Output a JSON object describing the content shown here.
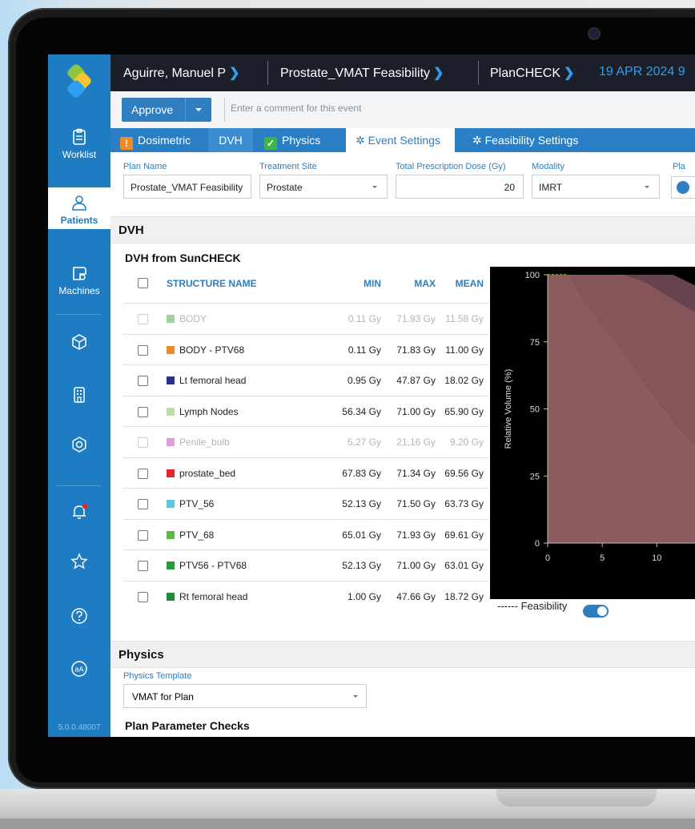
{
  "header": {
    "patient": "Aguirre, Manuel P",
    "plan": "Prostate_VMAT Feasibility",
    "module": "PlanCHECK",
    "date": "19 APR 2024 9"
  },
  "sidebar": {
    "items": [
      {
        "label": "Worklist",
        "icon": "clipboard-icon"
      },
      {
        "label": "Patients",
        "icon": "person-icon"
      },
      {
        "label": "Machines",
        "icon": "machine-icon"
      }
    ],
    "version": "5.0.0.48007"
  },
  "actionbar": {
    "approve_label": "Approve",
    "comment_placeholder": "Enter a comment for this event"
  },
  "tabs": {
    "dosimetric": "Dosimetric",
    "dvh": "DVH",
    "physics": "Physics",
    "event_settings": "Event Settings",
    "feasibility_settings": "Feasibility Settings"
  },
  "plan_fields": {
    "plan_name_label": "Plan Name",
    "plan_name": "Prostate_VMAT Feasibility",
    "treatment_site_label": "Treatment Site",
    "treatment_site": "Prostate",
    "dose_label": "Total Prescription Dose (Gy)",
    "dose": "20",
    "modality_label": "Modality",
    "modality": "IMRT",
    "cut_label": "Pla"
  },
  "dvh": {
    "section_title": "DVH",
    "subtitle": "DVH from SunCHECK",
    "columns": {
      "name": "STRUCTURE NAME",
      "min": "MIN",
      "max": "MAX",
      "mean": "MEAN"
    },
    "rows": [
      {
        "name": "BODY",
        "min": "0.11 Gy",
        "max": "71.93 Gy",
        "mean": "11.58 Gy",
        "color": "#4caf50",
        "dim": true
      },
      {
        "name": "BODY - PTV68",
        "min": "0.11 Gy",
        "max": "71.83 Gy",
        "mean": "11.00 Gy",
        "color": "#f08a24",
        "dim": false
      },
      {
        "name": "Lt femoral head",
        "min": "0.95 Gy",
        "max": "47.87 Gy",
        "mean": "18.02 Gy",
        "color": "#2b2f8f",
        "dim": false
      },
      {
        "name": "Lymph Nodes",
        "min": "56.34 Gy",
        "max": "71.00 Gy",
        "mean": "65.90 Gy",
        "color": "#b9e0a5",
        "dim": false
      },
      {
        "name": "Penile_bulb",
        "min": "5.27 Gy",
        "max": "21.16 Gy",
        "mean": "9.20 Gy",
        "color": "#c84fb0",
        "dim": true
      },
      {
        "name": "prostate_bed",
        "min": "67.83 Gy",
        "max": "71.34 Gy",
        "mean": "69.56 Gy",
        "color": "#e8232a",
        "dim": false
      },
      {
        "name": "PTV_56",
        "min": "52.13 Gy",
        "max": "71.50 Gy",
        "mean": "63.73 Gy",
        "color": "#5bc8e0",
        "dim": false
      },
      {
        "name": "PTV_68",
        "min": "65.01 Gy",
        "max": "71.93 Gy",
        "mean": "69.61 Gy",
        "color": "#5ab946",
        "dim": false
      },
      {
        "name": "PTV56 - PTV68",
        "min": "52.13 Gy",
        "max": "71.00 Gy",
        "mean": "63.01 Gy",
        "color": "#1f9e3a",
        "dim": false
      },
      {
        "name": "Rt femoral head",
        "min": "1.00 Gy",
        "max": "47.66 Gy",
        "mean": "18.72 Gy",
        "color": "#1e8c3a",
        "dim": false
      }
    ],
    "legend_label": "------ Feasibility",
    "feasibility_on": true
  },
  "chart_data": {
    "type": "area",
    "ylabel": "Relative Volume (%)",
    "xlabel": "",
    "y_ticks": [
      "100",
      "75",
      "50",
      "25",
      "0"
    ],
    "x_ticks": [
      "0",
      "5",
      "10"
    ],
    "ylim": [
      0,
      100
    ],
    "xlim": [
      0,
      13.5
    ],
    "grid": false,
    "series": [
      {
        "color": "#8a8a3a",
        "x": [
          0,
          1.8,
          3,
          5,
          7,
          9,
          10.5,
          12,
          13.5
        ],
        "y": [
          100,
          100,
          92,
          80,
          70,
          58,
          50,
          42,
          36
        ],
        "dashed_outline": true
      },
      {
        "color": "#a0603a",
        "x": [
          0,
          7,
          9,
          11,
          13.5
        ],
        "y": [
          100,
          100,
          97,
          92,
          86
        ]
      },
      {
        "color": "#8a5a6a",
        "x": [
          0,
          11.5,
          13.5
        ],
        "y": [
          100,
          100,
          96
        ]
      }
    ]
  },
  "physics": {
    "section_title": "Physics",
    "template_label": "Physics Template",
    "template_value": "VMAT for Plan",
    "checks_title": "Plan Parameter Checks"
  }
}
